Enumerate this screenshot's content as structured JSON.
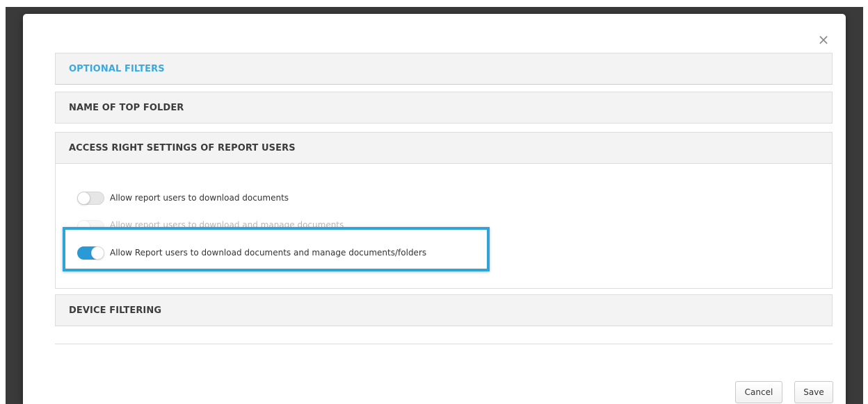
{
  "modal": {
    "close_glyph": "×",
    "sections": {
      "optional_filters": "OPTIONAL FILTERS",
      "name_of_top_folder": "NAME OF TOP FOLDER",
      "access_right_settings": "ACCESS RIGHT SETTINGS OF REPORT USERS",
      "device_filtering": "DEVICE FILTERING"
    },
    "access_options": [
      {
        "label": "Allow report users to download documents",
        "enabled": false
      },
      {
        "label": "Allow report users to download and manage documents",
        "enabled": false
      },
      {
        "label": "Allow Report users to download documents and manage documents/folders",
        "enabled": true
      }
    ],
    "footer": {
      "cancel_label": "Cancel",
      "save_label": "Save"
    }
  },
  "colors": {
    "accent": "#2a9ad6",
    "highlight_border": "#2ea4d8",
    "section_active_text": "#3aa9de"
  },
  "icons": {
    "close": "close-icon"
  }
}
